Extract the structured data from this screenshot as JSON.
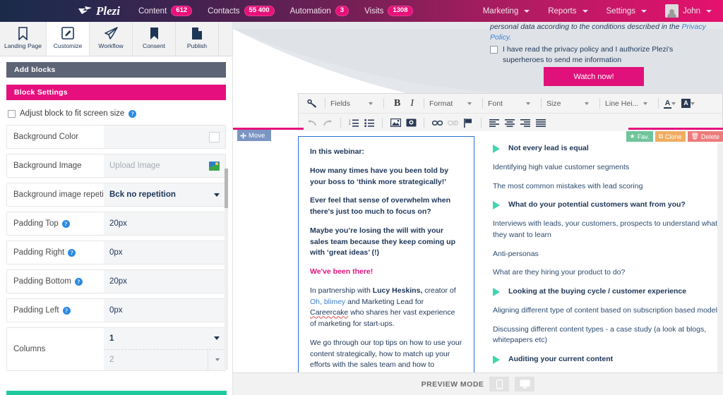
{
  "topnav": {
    "brand": "Plezi",
    "left_items": [
      {
        "label": "Content",
        "badge": "612"
      },
      {
        "label": "Contacts",
        "badge": "55 400"
      },
      {
        "label": "Automation",
        "badge": "3"
      },
      {
        "label": "Visits",
        "badge": "1308"
      }
    ],
    "right_items": [
      {
        "label": "Marketing"
      },
      {
        "label": "Reports"
      },
      {
        "label": "Settings"
      }
    ],
    "user": "John",
    "accent_pink": "#e8117a",
    "gradient_start": "#1b2a4a",
    "gradient_end": "#e5116e"
  },
  "tabs": [
    {
      "label": "Landing Page",
      "icon": "bookmark-outline-icon",
      "active": false
    },
    {
      "label": "Customize",
      "icon": "pencil-square-icon",
      "active": true
    },
    {
      "label": "Workflow",
      "icon": "paper-plane-icon",
      "active": false
    },
    {
      "label": "Consent",
      "icon": "bookmark-filled-icon",
      "active": false
    },
    {
      "label": "Publish",
      "icon": "document-icon",
      "active": false
    }
  ],
  "sidebar": {
    "add_blocks": "Add blocks",
    "block_settings": "Block Settings",
    "adjust_checkbox": "Adjust block to fit screen size",
    "fields": [
      {
        "label": "Background Color",
        "value": "",
        "control": "color"
      },
      {
        "label": "Background Image",
        "value": "Upload Image",
        "control": "upload",
        "placeholder": true
      },
      {
        "label": "Background image repetition",
        "value": "Bck no repetition",
        "control": "select"
      },
      {
        "label": "Padding Top",
        "value": "20px",
        "control": "text",
        "help": true
      },
      {
        "label": "Padding Right",
        "value": "0px",
        "control": "text",
        "help": true
      },
      {
        "label": "Padding Bottom",
        "value": "20px",
        "control": "text",
        "help": true
      },
      {
        "label": "Padding Left",
        "value": "0px",
        "control": "text",
        "help": true
      }
    ],
    "columns": {
      "label": "Columns",
      "value_primary": "1",
      "value_secondary": "2"
    }
  },
  "canvas": {
    "privacy_text": "personal data according to the conditions described in the ",
    "privacy_link": "Privacy Policy.",
    "consent_text": "I have read the privacy policy and I authorize Plezi's superheroes to send me information",
    "watch_button": "Watch now!",
    "move_tag": "Move",
    "action_buttons": [
      {
        "label": "Fav.",
        "icon": "star-icon",
        "color": "#6fc59a"
      },
      {
        "label": "Clone",
        "icon": "copy-icon",
        "color": "#f0ad63"
      },
      {
        "label": "Delete",
        "icon": "trash-icon",
        "color": "#ec7b7b"
      }
    ]
  },
  "rte": {
    "row1": [
      {
        "type": "icon",
        "name": "link-chain-icon"
      },
      {
        "type": "sep"
      },
      {
        "type": "dropdown",
        "label": "Fields"
      },
      {
        "type": "sep"
      },
      {
        "type": "bold",
        "label": "B"
      },
      {
        "type": "italic",
        "label": "I"
      },
      {
        "type": "sep"
      },
      {
        "type": "dropdown",
        "label": "Format"
      },
      {
        "type": "sep"
      },
      {
        "type": "dropdown",
        "label": "Font"
      },
      {
        "type": "sep"
      },
      {
        "type": "dropdown",
        "label": "Size"
      },
      {
        "type": "sep"
      },
      {
        "type": "dropdown",
        "label": "Line Hei..."
      },
      {
        "type": "sep"
      },
      {
        "type": "dropdown",
        "label": "A"
      },
      {
        "type": "dropdown",
        "label": "A"
      }
    ],
    "row2_icons": [
      "undo-icon",
      "redo-icon",
      "ordered-list-icon",
      "unordered-list-icon",
      "image-icon",
      "media-icon",
      "link-icon",
      "unlink-icon",
      "flag-icon",
      "align-left-icon",
      "align-center-icon",
      "align-right-icon",
      "align-justify-icon"
    ]
  },
  "left_block": {
    "paragraphs": [
      {
        "text": "In this webinar:",
        "style": "bold"
      },
      {
        "text": "How many times have you been told by your boss to ‘think more strategically!’",
        "style": "bold"
      },
      {
        "text": "Ever feel that sense of overwhelm when there's just too much to focus on?",
        "style": "bold"
      },
      {
        "text": "Maybe you’re losing the will with your sales team because they keep coming up with ‘great ideas’ (!)",
        "style": "bold"
      },
      {
        "text": "We've been there!",
        "style": "pink"
      }
    ],
    "partnership": {
      "prefix": "In partnership with ",
      "name": "Lucy Heskins,",
      "mid": " creator of ",
      "link": "Oh, blimey",
      "mid2": " and Marketing Lead for ",
      "brand": "Careercake",
      "suffix": " who shares her vast experience of marketing for start-ups."
    },
    "closing": "We go through our top tips on how to use your content strategically, how to match up your efforts with the sales team and how to"
  },
  "right_block": {
    "lines": [
      {
        "text": "Not every lead is equal",
        "head": true
      },
      {
        "text": "Identifying high value customer segments",
        "head": false
      },
      {
        "text": "The most common mistakes with lead scoring",
        "head": false
      },
      {
        "text": "What do your potential customers want from you?",
        "head": true
      },
      {
        "text": "Interviews with leads, your customers, prospects to understand what they want to learn",
        "head": false
      },
      {
        "text": "Anti-personas",
        "head": false
      },
      {
        "text": "What are they hiring your product to do?",
        "head": false
      },
      {
        "text": "Looking at the buying cycle / customer experience",
        "head": true
      },
      {
        "text": "Aligning different type of content based on subscription based models",
        "head": false
      },
      {
        "text": "Discussing different content types - a case study (a look at blogs, whitepapers etc)",
        "head": false
      },
      {
        "text": "Auditing your current content",
        "head": true
      }
    ],
    "bullet_color": "#3fd6ae"
  },
  "bottombar": {
    "label": "PREVIEW MODE",
    "buttons": [
      {
        "name": "mobile-preview",
        "icon": "mobile-icon"
      },
      {
        "name": "desktop-preview",
        "icon": "desktop-icon"
      }
    ]
  }
}
